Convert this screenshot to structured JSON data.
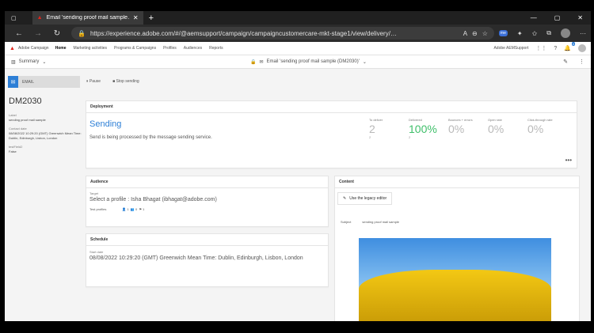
{
  "browser": {
    "tab_title": "Email 'sending proof mail sample…",
    "url": "https://experience.adobe.com/#/@aemsupport/campaign/campaigncustomercare-mkt-stage1/view/delivery/…"
  },
  "app": {
    "name": "Adobe Campaign",
    "nav": [
      "Home",
      "Marketing activities",
      "Programs & Campaigns",
      "Profiles",
      "Audiences",
      "Reports"
    ],
    "org": "Adobe AEMSupport",
    "notification_count": "4"
  },
  "subheader": {
    "summary": "Summary",
    "breadcrumb": "Email 'sending proof mail sample (DM2030)'"
  },
  "sidebar": {
    "type_label": "EMAIL",
    "id": "DM2030",
    "fields": [
      {
        "label": "Label",
        "value": "sending proof mail sample"
      },
      {
        "label": "Contact date",
        "value": "08/08/2022 10:29:20 (GMT) Greenwich Mean Time: Dublin, Edinburgh, Lisbon, London"
      },
      {
        "label": "testField2",
        "value": "False"
      }
    ]
  },
  "actions": {
    "pause": "Pause",
    "stop": "Stop sending"
  },
  "deployment": {
    "title": "Deployment",
    "status": "Sending",
    "description": "Send is being processed by the message sending service.",
    "metrics": [
      {
        "label": "To deliver",
        "value": "2",
        "sub": "2",
        "color": "#b9b9b9"
      },
      {
        "label": "Delivered",
        "value": "100%",
        "sub": "2",
        "color": "#3fbf6a"
      },
      {
        "label": "Bounces + errors",
        "value": "0%",
        "sub": "",
        "color": "#b9b9b9"
      },
      {
        "label": "Open rate",
        "value": "0%",
        "sub": "",
        "color": "#b9b9b9"
      },
      {
        "label": "Click-through rate",
        "value": "0%",
        "sub": "",
        "color": "#b9b9b9"
      }
    ]
  },
  "audience": {
    "title": "Audience",
    "target_label": "Target",
    "target_value": "Select a profile : Isha Bhagat (ibhagat@adobe.com)",
    "test_profiles_label": "Test profiles",
    "test_counts": [
      "1",
      "0",
      "1"
    ]
  },
  "schedule": {
    "title": "Schedule",
    "start_label": "Start date",
    "start_value": "08/08/2022 10:29:20 (GMT) Greenwich Mean Time: Dublin, Edinburgh, Lisbon, London"
  },
  "content": {
    "title": "Content",
    "legacy_button": "Use the legacy editor",
    "subject_label": "Subject",
    "subject_value": "sending proof mail sample"
  }
}
